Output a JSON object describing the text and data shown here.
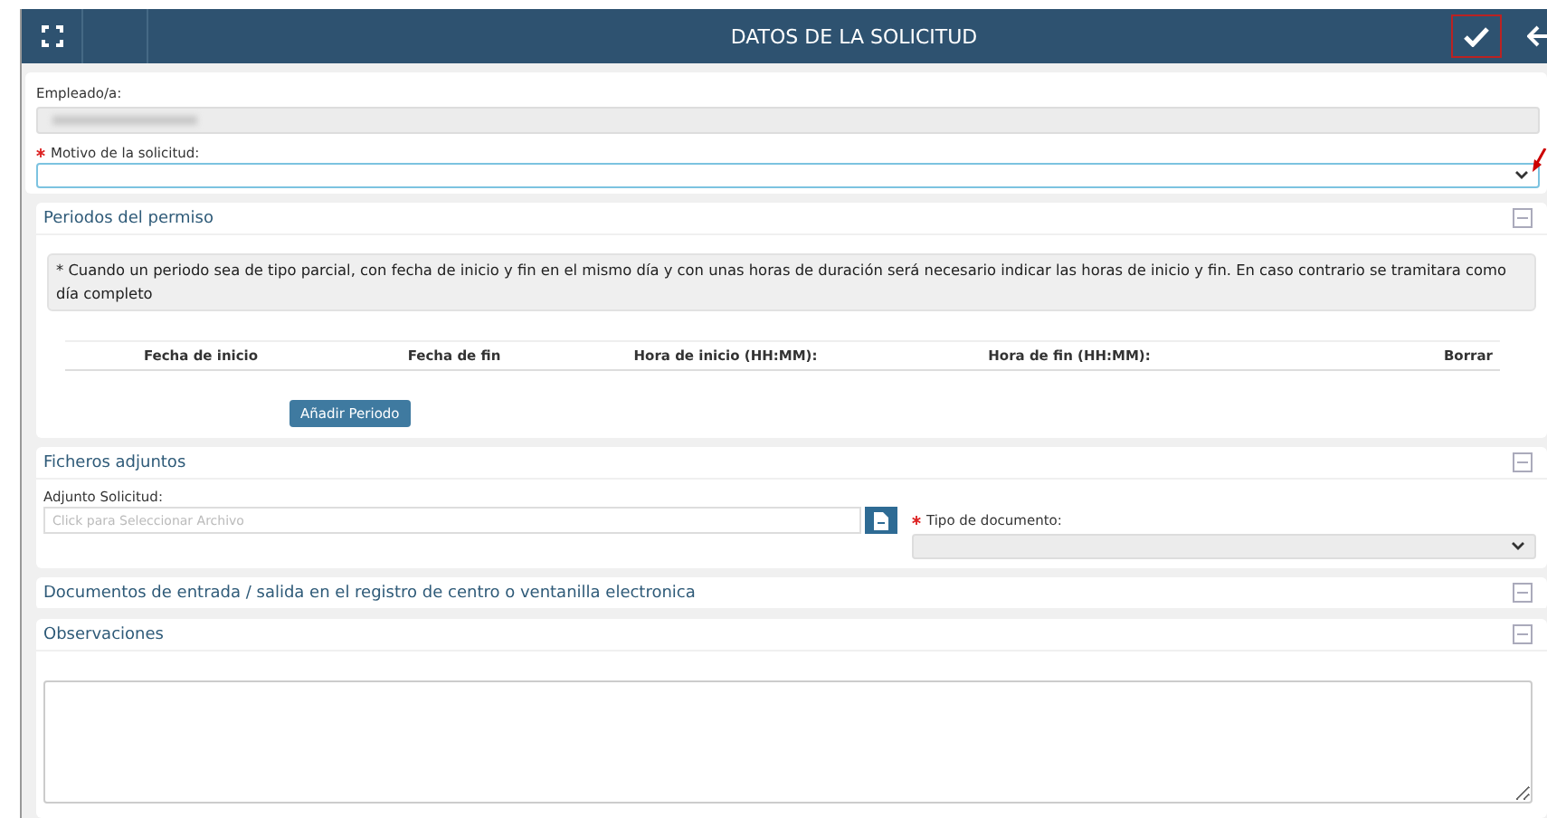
{
  "header": {
    "title": "DATOS DE LA SOLICITUD"
  },
  "employee": {
    "label": "Empleado/a:"
  },
  "reason": {
    "label": "Motivo de la solicitud:",
    "required": true
  },
  "periods": {
    "title": "Periodos del permiso",
    "note": "* Cuando un periodo sea de tipo parcial, con fecha de inicio y fin en el mismo día y con unas horas de duración será necesario indicar las horas de inicio y fin. En caso contrario se tramitara como día completo",
    "columns": [
      "Fecha de inicio",
      "Fecha de fin",
      "Hora de inicio (HH:MM):",
      "Hora de fin (HH:MM):",
      "Borrar"
    ],
    "add_button": "Añadir Periodo"
  },
  "attachments": {
    "title": "Ficheros adjuntos",
    "file_label": "Adjunto Solicitud:",
    "file_placeholder": "Click para Seleccionar Archivo",
    "type_label": "Tipo de documento:",
    "type_required": true
  },
  "documents": {
    "title": "Documentos de entrada / salida en el registro de centro o ventanilla electronica"
  },
  "observations": {
    "title": "Observaciones"
  }
}
